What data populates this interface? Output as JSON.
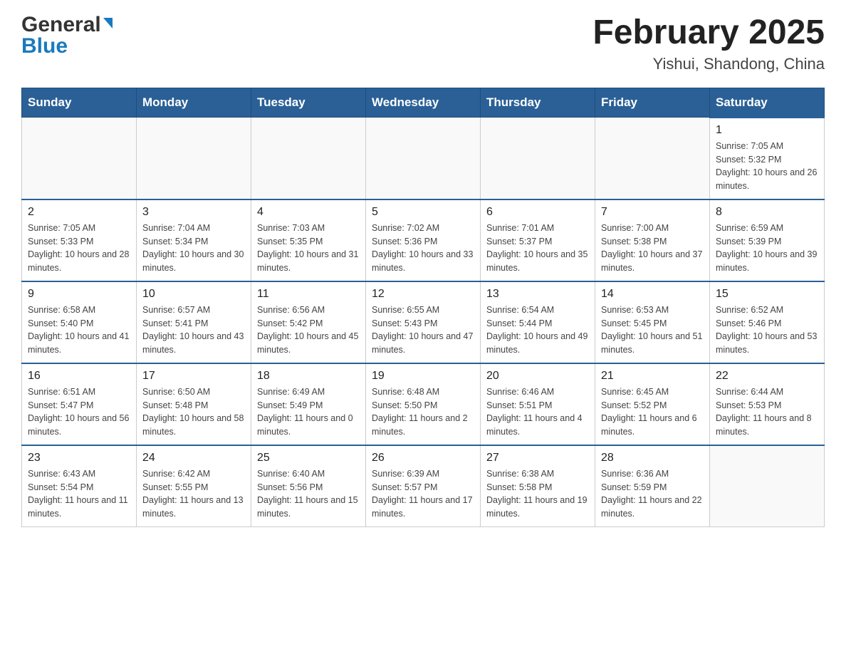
{
  "header": {
    "logo_general": "General",
    "logo_blue": "Blue",
    "month_title": "February 2025",
    "location": "Yishui, Shandong, China"
  },
  "weekdays": [
    "Sunday",
    "Monday",
    "Tuesday",
    "Wednesday",
    "Thursday",
    "Friday",
    "Saturday"
  ],
  "weeks": [
    [
      {
        "day": "",
        "info": ""
      },
      {
        "day": "",
        "info": ""
      },
      {
        "day": "",
        "info": ""
      },
      {
        "day": "",
        "info": ""
      },
      {
        "day": "",
        "info": ""
      },
      {
        "day": "",
        "info": ""
      },
      {
        "day": "1",
        "info": "Sunrise: 7:05 AM\nSunset: 5:32 PM\nDaylight: 10 hours and 26 minutes."
      }
    ],
    [
      {
        "day": "2",
        "info": "Sunrise: 7:05 AM\nSunset: 5:33 PM\nDaylight: 10 hours and 28 minutes."
      },
      {
        "day": "3",
        "info": "Sunrise: 7:04 AM\nSunset: 5:34 PM\nDaylight: 10 hours and 30 minutes."
      },
      {
        "day": "4",
        "info": "Sunrise: 7:03 AM\nSunset: 5:35 PM\nDaylight: 10 hours and 31 minutes."
      },
      {
        "day": "5",
        "info": "Sunrise: 7:02 AM\nSunset: 5:36 PM\nDaylight: 10 hours and 33 minutes."
      },
      {
        "day": "6",
        "info": "Sunrise: 7:01 AM\nSunset: 5:37 PM\nDaylight: 10 hours and 35 minutes."
      },
      {
        "day": "7",
        "info": "Sunrise: 7:00 AM\nSunset: 5:38 PM\nDaylight: 10 hours and 37 minutes."
      },
      {
        "day": "8",
        "info": "Sunrise: 6:59 AM\nSunset: 5:39 PM\nDaylight: 10 hours and 39 minutes."
      }
    ],
    [
      {
        "day": "9",
        "info": "Sunrise: 6:58 AM\nSunset: 5:40 PM\nDaylight: 10 hours and 41 minutes."
      },
      {
        "day": "10",
        "info": "Sunrise: 6:57 AM\nSunset: 5:41 PM\nDaylight: 10 hours and 43 minutes."
      },
      {
        "day": "11",
        "info": "Sunrise: 6:56 AM\nSunset: 5:42 PM\nDaylight: 10 hours and 45 minutes."
      },
      {
        "day": "12",
        "info": "Sunrise: 6:55 AM\nSunset: 5:43 PM\nDaylight: 10 hours and 47 minutes."
      },
      {
        "day": "13",
        "info": "Sunrise: 6:54 AM\nSunset: 5:44 PM\nDaylight: 10 hours and 49 minutes."
      },
      {
        "day": "14",
        "info": "Sunrise: 6:53 AM\nSunset: 5:45 PM\nDaylight: 10 hours and 51 minutes."
      },
      {
        "day": "15",
        "info": "Sunrise: 6:52 AM\nSunset: 5:46 PM\nDaylight: 10 hours and 53 minutes."
      }
    ],
    [
      {
        "day": "16",
        "info": "Sunrise: 6:51 AM\nSunset: 5:47 PM\nDaylight: 10 hours and 56 minutes."
      },
      {
        "day": "17",
        "info": "Sunrise: 6:50 AM\nSunset: 5:48 PM\nDaylight: 10 hours and 58 minutes."
      },
      {
        "day": "18",
        "info": "Sunrise: 6:49 AM\nSunset: 5:49 PM\nDaylight: 11 hours and 0 minutes."
      },
      {
        "day": "19",
        "info": "Sunrise: 6:48 AM\nSunset: 5:50 PM\nDaylight: 11 hours and 2 minutes."
      },
      {
        "day": "20",
        "info": "Sunrise: 6:46 AM\nSunset: 5:51 PM\nDaylight: 11 hours and 4 minutes."
      },
      {
        "day": "21",
        "info": "Sunrise: 6:45 AM\nSunset: 5:52 PM\nDaylight: 11 hours and 6 minutes."
      },
      {
        "day": "22",
        "info": "Sunrise: 6:44 AM\nSunset: 5:53 PM\nDaylight: 11 hours and 8 minutes."
      }
    ],
    [
      {
        "day": "23",
        "info": "Sunrise: 6:43 AM\nSunset: 5:54 PM\nDaylight: 11 hours and 11 minutes."
      },
      {
        "day": "24",
        "info": "Sunrise: 6:42 AM\nSunset: 5:55 PM\nDaylight: 11 hours and 13 minutes."
      },
      {
        "day": "25",
        "info": "Sunrise: 6:40 AM\nSunset: 5:56 PM\nDaylight: 11 hours and 15 minutes."
      },
      {
        "day": "26",
        "info": "Sunrise: 6:39 AM\nSunset: 5:57 PM\nDaylight: 11 hours and 17 minutes."
      },
      {
        "day": "27",
        "info": "Sunrise: 6:38 AM\nSunset: 5:58 PM\nDaylight: 11 hours and 19 minutes."
      },
      {
        "day": "28",
        "info": "Sunrise: 6:36 AM\nSunset: 5:59 PM\nDaylight: 11 hours and 22 minutes."
      },
      {
        "day": "",
        "info": ""
      }
    ]
  ]
}
